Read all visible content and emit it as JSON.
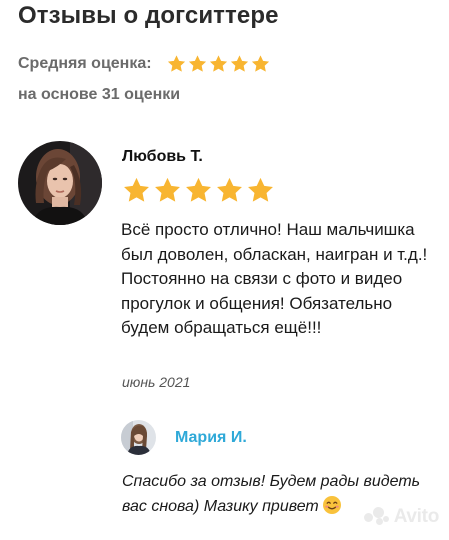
{
  "page": {
    "title": "Отзывы о догситтере",
    "average_label": "Средняя оценка:",
    "average_rating": 5,
    "average_max": 5,
    "based_on": "на основе 31 оценки"
  },
  "review": {
    "author": "Любовь Т.",
    "rating": 5,
    "rating_max": 5,
    "text": "Всё просто отлично! Наш мальчишка был доволен, обласкан, наигран и т.д.! Постоянно на связи с фото и видео прогулок и общения! Обязательно будем обращаться ещё!!!",
    "date": "июнь 2021"
  },
  "reply": {
    "author": "Мария И.",
    "text": "Спасибо за отзыв! Будем рады видеть вас снова) Мазику привет",
    "emoji": "smiling-face-with-hearts-icon"
  },
  "watermark": {
    "text": "Avito"
  },
  "colors": {
    "star": "#f8b531",
    "reply_name": "#2fa9d8",
    "muted_text": "#6b6b6b"
  }
}
